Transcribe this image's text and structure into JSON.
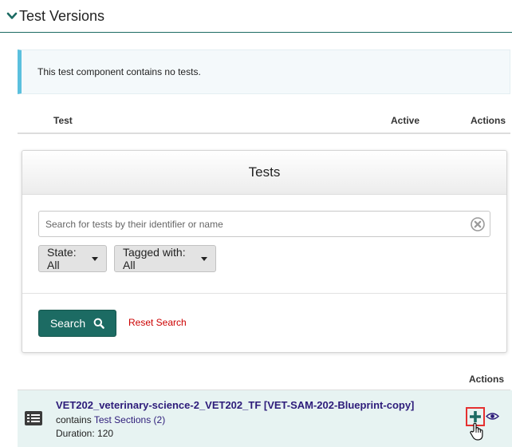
{
  "section": {
    "title": "Test Versions"
  },
  "alert": {
    "message": "This test component contains no tests."
  },
  "table": {
    "col_test": "Test",
    "col_active": "Active",
    "col_actions": "Actions"
  },
  "panel": {
    "title": "Tests",
    "search_placeholder": "Search for tests by their identifier or name",
    "state_filter": "State: All",
    "tag_filter": "Tagged with: All",
    "search_button": "Search",
    "reset_link": "Reset Search"
  },
  "results": {
    "actions_header": "Actions",
    "items": [
      {
        "title": "VET202_veterinary-science-2_VET202_TF [VET-SAM-202-Blueprint-copy]",
        "contains_prefix": "contains",
        "sections_link": "Test Sections (2)",
        "duration": "Duration: 120"
      }
    ]
  },
  "colors": {
    "accent": "#1c6b63",
    "link": "#2d1c7a",
    "reset": "#cc0000",
    "info_border": "#5bc0de",
    "row_highlight": "#e7f3f2",
    "focus_outline": "#e53030"
  }
}
